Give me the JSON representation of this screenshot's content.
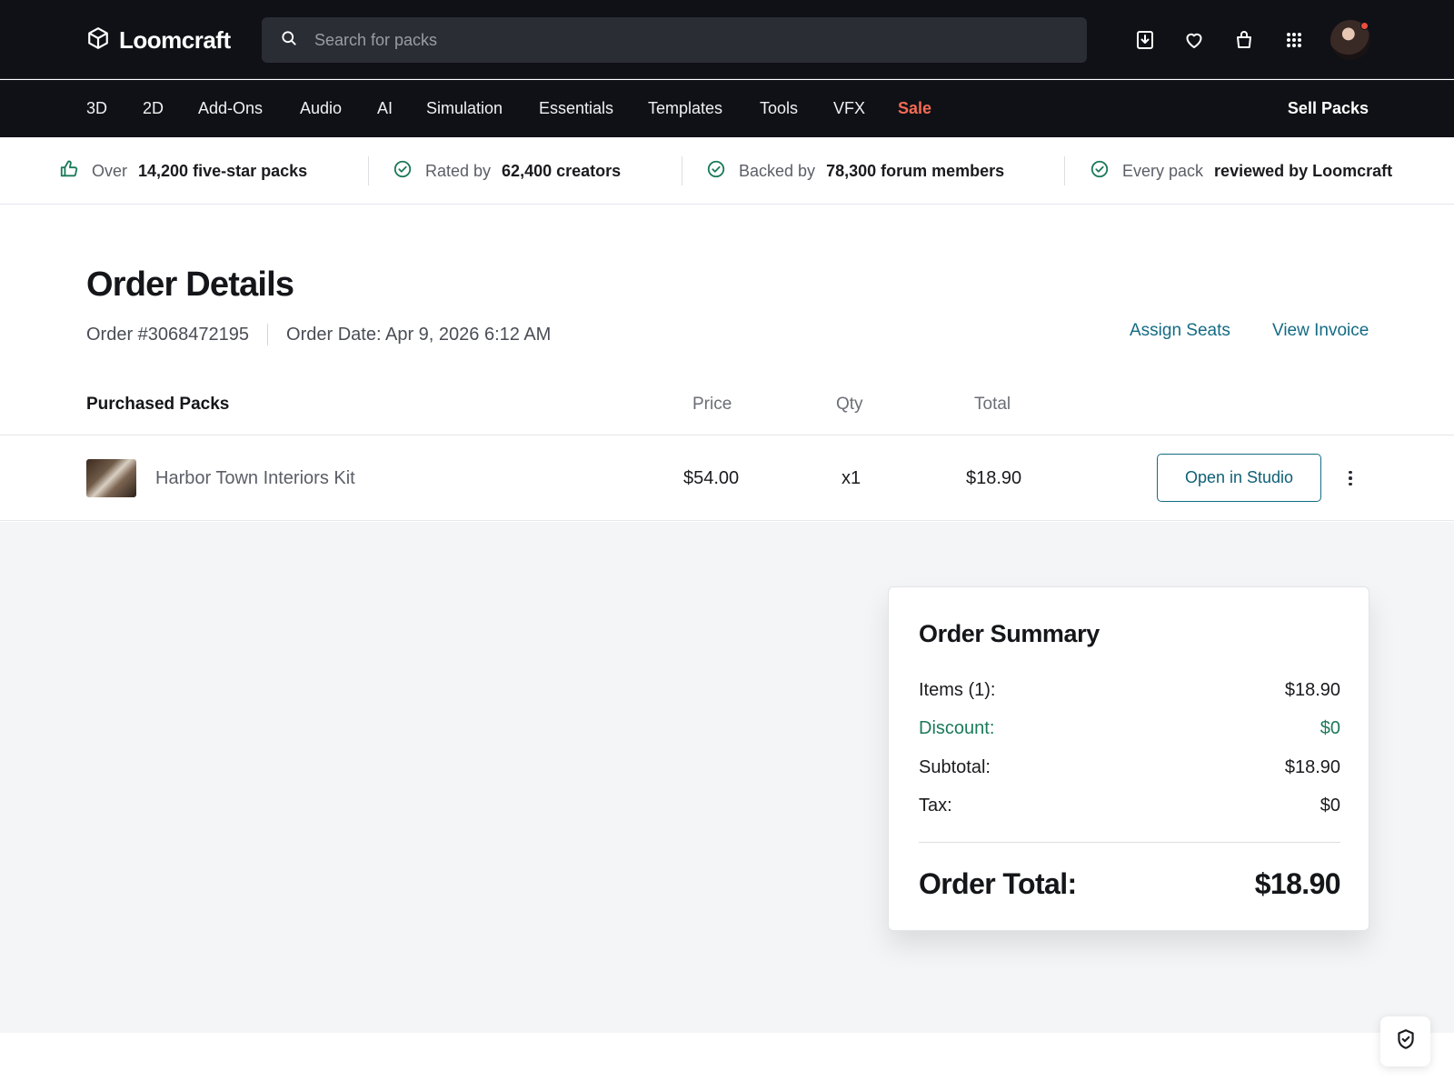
{
  "brand": {
    "name": "Loomcraft",
    "icon": "cube-icon"
  },
  "search": {
    "placeholder": "Search for packs",
    "icon": "search-icon"
  },
  "top_icons": [
    "download-icon",
    "heart-icon",
    "shopping-bag-icon",
    "apps-grid-icon"
  ],
  "nav": {
    "items": [
      "3D",
      "2D",
      "Add-Ons",
      "Audio",
      "AI",
      "Simulation",
      "Essentials",
      "Templates",
      "Tools",
      "VFX",
      "Sale"
    ],
    "sell_label": "Sell Packs",
    "sale_color": "#f56a54"
  },
  "trust": [
    {
      "icon": "thumbs-up-icon",
      "lead": "Over",
      "strong": "14,200 five-star packs"
    },
    {
      "icon": "check-circle-icon",
      "lead": "Rated by",
      "strong": "62,400 creators"
    },
    {
      "icon": "check-circle-icon",
      "lead": "Backed by",
      "strong": "78,300 forum members"
    },
    {
      "icon": "check-circle-icon",
      "lead": "Every pack",
      "strong": "reviewed by Loomcraft"
    }
  ],
  "order": {
    "title": "Order Details",
    "number": "Order #3068472195",
    "date": "Order Date: Apr 9, 2026 6:12 AM",
    "assign_label": "Assign Seats",
    "invoice_label": "View Invoice"
  },
  "table": {
    "headers": {
      "item": "Purchased Packs",
      "price": "Price",
      "qty": "Qty",
      "total": "Total"
    },
    "rows": [
      {
        "name": "Harbor Town Interiors Kit",
        "price": "$54.00",
        "qty": "x1",
        "total": "$18.90",
        "action": "Open in Studio"
      }
    ]
  },
  "summary": {
    "title": "Order Summary",
    "items_label": "Items (1):",
    "items_value": "$18.90",
    "discount_label": "Discount:",
    "discount_value": "$0",
    "subtotal_label": "Subtotal:",
    "subtotal_value": "$18.90",
    "tax_label": "Tax:",
    "tax_value": "$0",
    "total_label": "Order Total:",
    "total_value": "$18.90"
  },
  "colors": {
    "accent": "#146b84",
    "discount": "#1c7a5a",
    "header_bg": "#101116"
  }
}
